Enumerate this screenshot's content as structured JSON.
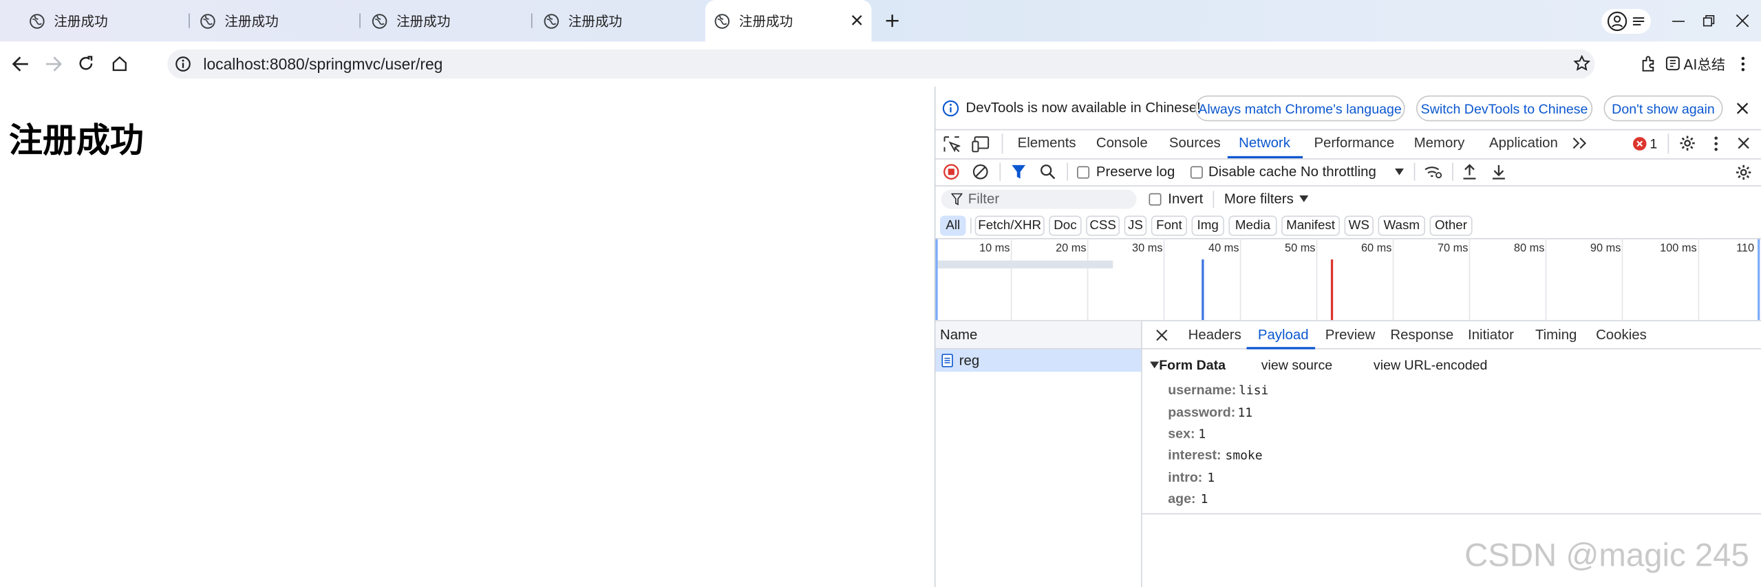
{
  "tabs": [
    {
      "title": "注册成功"
    },
    {
      "title": "注册成功"
    },
    {
      "title": "注册成功"
    },
    {
      "title": "注册成功"
    },
    {
      "title": "注册成功"
    }
  ],
  "toolbar": {
    "url": "localhost:8080/springmvc/user/reg",
    "ai_label": "AI总结"
  },
  "page": {
    "heading": "注册成功"
  },
  "devtools": {
    "infobar": {
      "message": "DevTools is now available in Chinese!",
      "btn_match": "Always match Chrome's language",
      "btn_switch": "Switch DevTools to Chinese",
      "btn_dismiss": "Don't show again"
    },
    "main_tabs": [
      "Elements",
      "Console",
      "Sources",
      "Network",
      "Performance",
      "Memory",
      "Application"
    ],
    "active_main_tab": "Network",
    "error_count": "1",
    "network_toolbar": {
      "preserve_log": "Preserve log",
      "disable_cache": "Disable cache",
      "throttling": "No throttling"
    },
    "filter": {
      "placeholder": "Filter",
      "invert": "Invert",
      "more_filters": "More filters"
    },
    "type_filters": [
      "All",
      "Fetch/XHR",
      "Doc",
      "CSS",
      "JS",
      "Font",
      "Img",
      "Media",
      "Manifest",
      "WS",
      "Wasm",
      "Other"
    ],
    "timeline_ticks": [
      "10 ms",
      "20 ms",
      "30 ms",
      "40 ms",
      "50 ms",
      "60 ms",
      "70 ms",
      "80 ms",
      "90 ms",
      "100 ms",
      "110"
    ],
    "requests": {
      "column": "Name",
      "rows": [
        {
          "name": "reg"
        }
      ]
    },
    "panel_tabs": [
      "Headers",
      "Payload",
      "Preview",
      "Response",
      "Initiator",
      "Timing",
      "Cookies"
    ],
    "active_panel_tab": "Payload",
    "form_data": {
      "title": "Form Data",
      "view_source": "view source",
      "view_url_encoded": "view URL-encoded",
      "fields": [
        {
          "key": "username:",
          "value": "lisi"
        },
        {
          "key": "password:",
          "value": "11"
        },
        {
          "key": "sex:",
          "value": "1"
        },
        {
          "key": "interest:",
          "value": "smoke"
        },
        {
          "key": "intro:",
          "value": "1"
        },
        {
          "key": "age:",
          "value": "1"
        }
      ]
    }
  },
  "watermark": "CSDN @magic 245",
  "colors": {
    "accent": "#0b57d0",
    "error": "#dc362e",
    "record": "#dc362e"
  }
}
